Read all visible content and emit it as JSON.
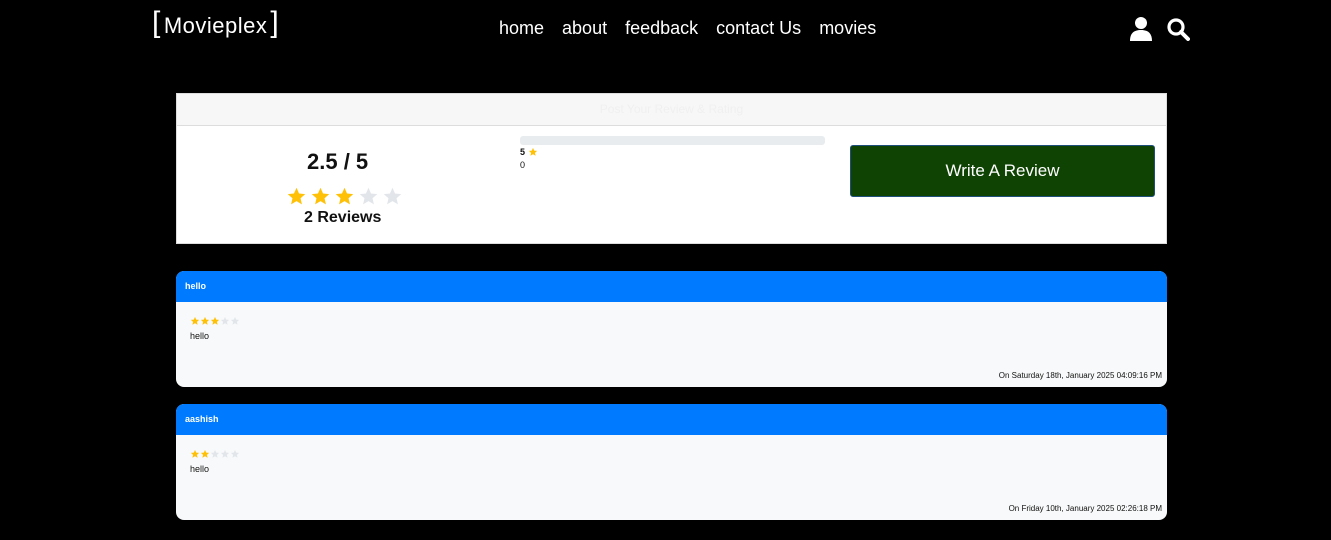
{
  "header": {
    "logo": "Movieplex",
    "nav": [
      "home",
      "about",
      "feedback",
      "contact Us",
      "movies"
    ],
    "icons": [
      "user-icon",
      "search-icon"
    ]
  },
  "rating_panel": {
    "header_text": "Post Your Review & Rating",
    "average": "2.5 / 5",
    "average_value": 2.5,
    "max_rating": 5,
    "reviews_count": "2 Reviews",
    "bar": {
      "label": "5",
      "count": "0",
      "fill_fraction": 0
    },
    "write_button": "Write A Review",
    "colors": {
      "star_filled": "#ffc107",
      "star_empty": "#e2e6ea",
      "button_bg": "#0e4303"
    }
  },
  "reviews": [
    {
      "name": "hello",
      "rating": 3,
      "text": "hello",
      "date": "On Saturday 18th, January 2025 04:09:16 PM"
    },
    {
      "name": "aashish",
      "rating": 2,
      "text": "hello",
      "date": "On Friday 10th, January 2025 02:26:18 PM"
    }
  ],
  "colors": {
    "card_header": "#007bff",
    "card_body": "#f8f9fa",
    "background": "#000000"
  }
}
